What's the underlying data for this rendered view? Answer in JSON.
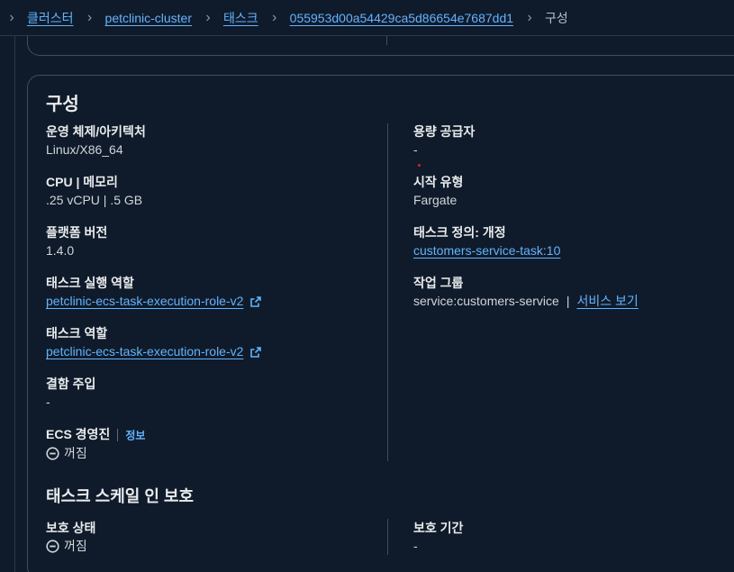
{
  "breadcrumb": {
    "items": [
      "클러스터",
      "petclinic-cluster",
      "태스크",
      "055953d00a54429ca5d86654e7687dd1"
    ],
    "current": "구성"
  },
  "panel": {
    "title": "구성",
    "left": {
      "os_label": "운영 체제/아키텍처",
      "os_value": "Linux/X86_64",
      "cpu_label": "CPU | 메모리",
      "cpu_value": ".25 vCPU | .5 GB",
      "platform_label": "플랫폼 버전",
      "platform_value": "1.4.0",
      "exec_role_label": "태스크 실행 역할",
      "exec_role_value": "petclinic-ecs-task-execution-role-v2",
      "task_role_label": "태스크 역할",
      "task_role_value": "petclinic-ecs-task-execution-role-v2",
      "fault_label": "결함 주입",
      "fault_value": "-",
      "ecs_label": "ECS 경영진",
      "ecs_info": "정보",
      "ecs_value": "꺼짐"
    },
    "right": {
      "capacity_label": "용량 공급자",
      "capacity_value": "-",
      "launch_label": "시작 유형",
      "launch_value": "Fargate",
      "taskdef_label": "태스크 정의: 개정",
      "taskdef_value": "customers-service-task:10",
      "group_label": "작업 그룹",
      "group_value": "service:customers-service",
      "group_separator": "|",
      "group_link": "서비스 보기"
    },
    "protection": {
      "title": "태스크 스케일 인 보호",
      "status_label": "보호 상태",
      "status_value": "꺼짐",
      "period_label": "보호 기간",
      "period_value": "-"
    }
  },
  "colors": {
    "background": "#0f1b2a",
    "link": "#5fb4ff",
    "border": "#414d5c"
  }
}
